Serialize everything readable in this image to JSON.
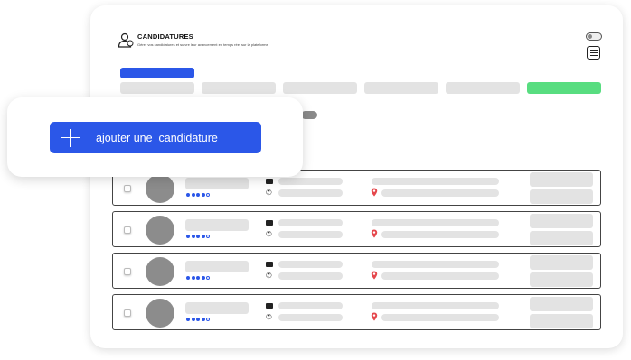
{
  "header": {
    "title": "CANDIDATURES",
    "subtitle": "Gérer vos candidatures et suivre leur avancement en temps réel sur la plateforme"
  },
  "actions": {
    "add_label": "ajouter une  candidature"
  },
  "colors": {
    "accent": "#2b57e8",
    "success": "#58dd80",
    "avatar": "#8c8c8c",
    "placeholder": "#e3e3e3",
    "pin": "#e5484d"
  },
  "icons": [
    "user-icon",
    "toggle-switch",
    "menu-icon",
    "plus-icon",
    "mail-icon",
    "phone-icon",
    "location-pin-icon"
  ],
  "tabs": [
    {
      "state": "active"
    },
    {
      "state": "inactive"
    },
    {
      "state": "inactive"
    },
    {
      "state": "inactive"
    },
    {
      "state": "inactive"
    },
    {
      "state": "success"
    }
  ],
  "candidates": [
    {
      "rating": 4,
      "rating_max": 5
    },
    {
      "rating": 4,
      "rating_max": 5
    },
    {
      "rating": 4,
      "rating_max": 5
    },
    {
      "rating": 4,
      "rating_max": 5
    }
  ]
}
